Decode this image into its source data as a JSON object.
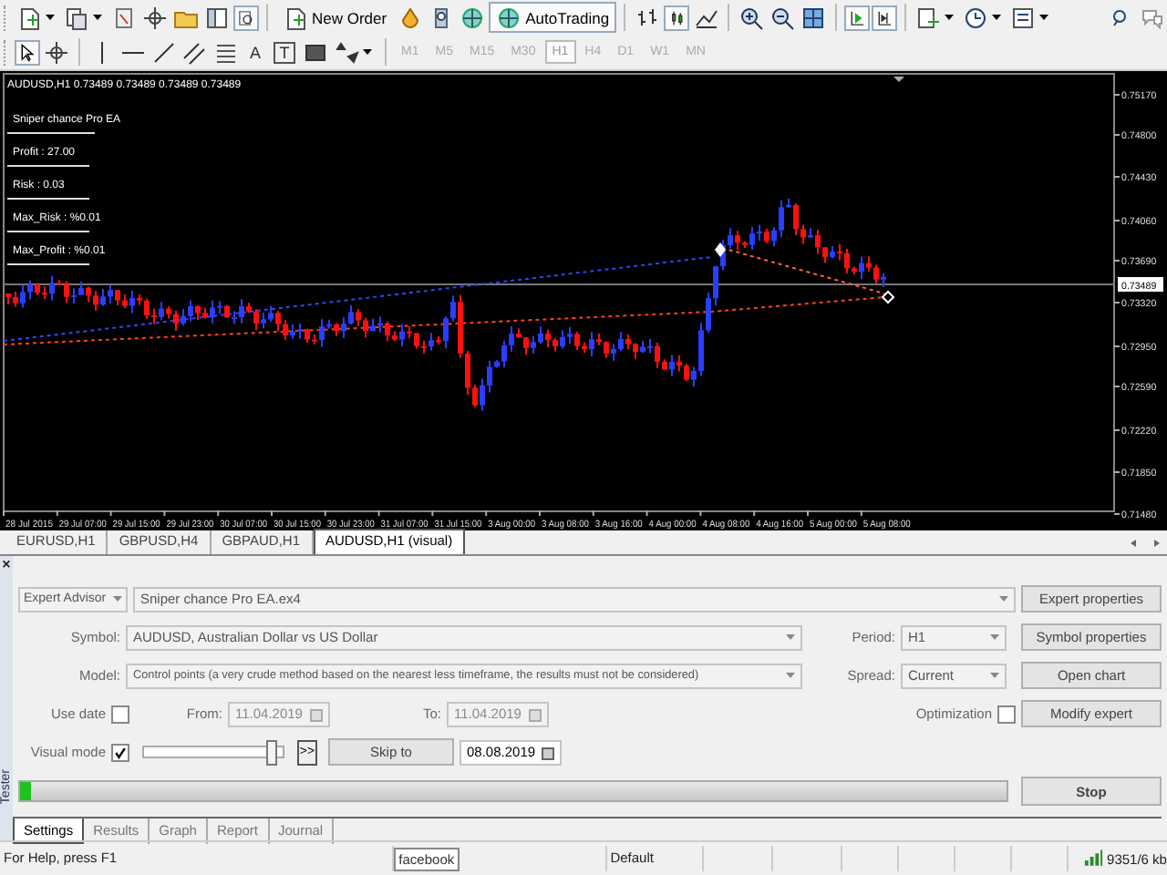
{
  "toolbar": {
    "new_order": "New Order",
    "auto_trading": "AutoTrading",
    "text_tool": "A",
    "label_tool": "T"
  },
  "timeframes": [
    {
      "label": "M1",
      "selected": false
    },
    {
      "label": "M5",
      "selected": false
    },
    {
      "label": "M15",
      "selected": false
    },
    {
      "label": "M30",
      "selected": false
    },
    {
      "label": "H1",
      "selected": true
    },
    {
      "label": "H4",
      "selected": false
    },
    {
      "label": "D1",
      "selected": false
    },
    {
      "label": "W1",
      "selected": false
    },
    {
      "label": "MN",
      "selected": false
    }
  ],
  "chart": {
    "title": "AUDUSD,H1  0.73489 0.73489 0.73489 0.73489",
    "ea_panel": [
      "Sniper chance Pro EA",
      "Profit : 27.00",
      "Risk : 0.03",
      "Max_Risk : %0.01",
      "Max_Profit : %0.01"
    ],
    "price_labels": [
      "0.75170",
      "0.74800",
      "0.74430",
      "0.74060",
      "0.73690",
      "0.73320",
      "0.72950",
      "0.72590",
      "0.72220",
      "0.71850",
      "0.71480"
    ],
    "current_price": "0.73489",
    "time_labels": [
      "28 Jul 2015",
      "29 Jul 07:00",
      "29 Jul 15:00",
      "29 Jul 23:00",
      "30 Jul 07:00",
      "30 Jul 15:00",
      "30 Jul 23:00",
      "31 Jul 07:00",
      "31 Jul 15:00",
      "3 Aug 00:00",
      "3 Aug 08:00",
      "3 Aug 16:00",
      "4 Aug 00:00",
      "4 Aug 08:00",
      "4 Aug 16:00",
      "5 Aug 00:00",
      "5 Aug 08:00"
    ]
  },
  "chart_tabs": [
    {
      "label": "EURUSD,H1",
      "selected": false
    },
    {
      "label": "GBPUSD,H4",
      "selected": false
    },
    {
      "label": "GBPAUD,H1",
      "selected": false
    },
    {
      "label": "AUDUSD,H1 (visual)",
      "selected": true
    }
  ],
  "tester": {
    "close": "×",
    "side_title": "Tester",
    "expert_type": "Expert Advisor",
    "expert": "Sniper chance Pro EA.ex4",
    "symbol_label": "Symbol:",
    "symbol": "AUDUSD, Australian Dollar vs US Dollar",
    "model_label": "Model:",
    "model": "Control points (a very crude method based on the nearest less timeframe, the results must not be considered)",
    "period_label": "Period:",
    "period": "H1",
    "spread_label": "Spread:",
    "spread": "Current",
    "use_date": {
      "label": "Use date",
      "checked": false
    },
    "from_label": "From:",
    "from": "11.04.2019",
    "to_label": "To:",
    "to": "11.04.2019",
    "optimization": {
      "label": "Optimization",
      "checked": false
    },
    "visual_mode": {
      "label": "Visual mode",
      "checked": true
    },
    "speed": {
      "level": 0.93
    },
    "skip_symbol": ">>",
    "skip_button": "Skip to",
    "skip_date": "08.08.2019",
    "buttons": [
      "Expert properties",
      "Symbol properties",
      "Open chart",
      "Modify expert"
    ],
    "progress": {
      "level": 0.012
    },
    "stop": "Stop"
  },
  "bottom_tabs": [
    {
      "label": "Settings",
      "selected": true
    },
    {
      "label": "Results",
      "selected": false
    },
    {
      "label": "Graph",
      "selected": false
    },
    {
      "label": "Report",
      "selected": false
    },
    {
      "label": "Journal",
      "selected": false
    }
  ],
  "status_bar": {
    "help": "For Help, press F1",
    "badge": "facebook",
    "profile": "Default",
    "traffic": "9351/6 kb"
  }
}
